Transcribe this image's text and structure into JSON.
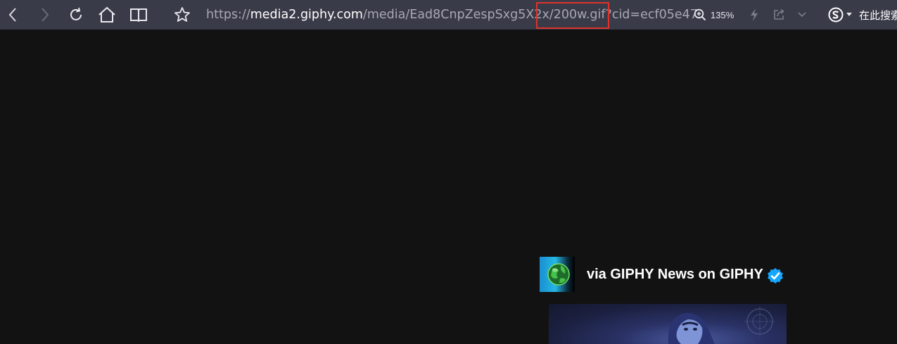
{
  "browser": {
    "nav": {
      "back_icon": "chevron-left-icon",
      "forward_icon": "chevron-right-icon",
      "reload_icon": "reload-icon",
      "home_icon": "home-icon",
      "reader_icon": "book-icon",
      "bookmark_icon": "star-icon"
    },
    "address": {
      "scheme": "https://",
      "host": "media2.giphy.com",
      "path": "/media/Ead8CnpZespSxg5X2x/200w.gif?cid=ecf05e47",
      "highlight_color": "#e0322b"
    },
    "zoom": {
      "label": "135%"
    },
    "search": {
      "engine_icon": "sogou-icon",
      "placeholder": "在此搜索"
    }
  },
  "page": {
    "attribution": {
      "text": "via GIPHY News on GIPHY",
      "verified_icon": "verified-badge-icon",
      "badge_color": "#15a7ff"
    }
  },
  "colors": {
    "toolbar_bg": "#3a3b48",
    "page_bg": "#121212"
  }
}
